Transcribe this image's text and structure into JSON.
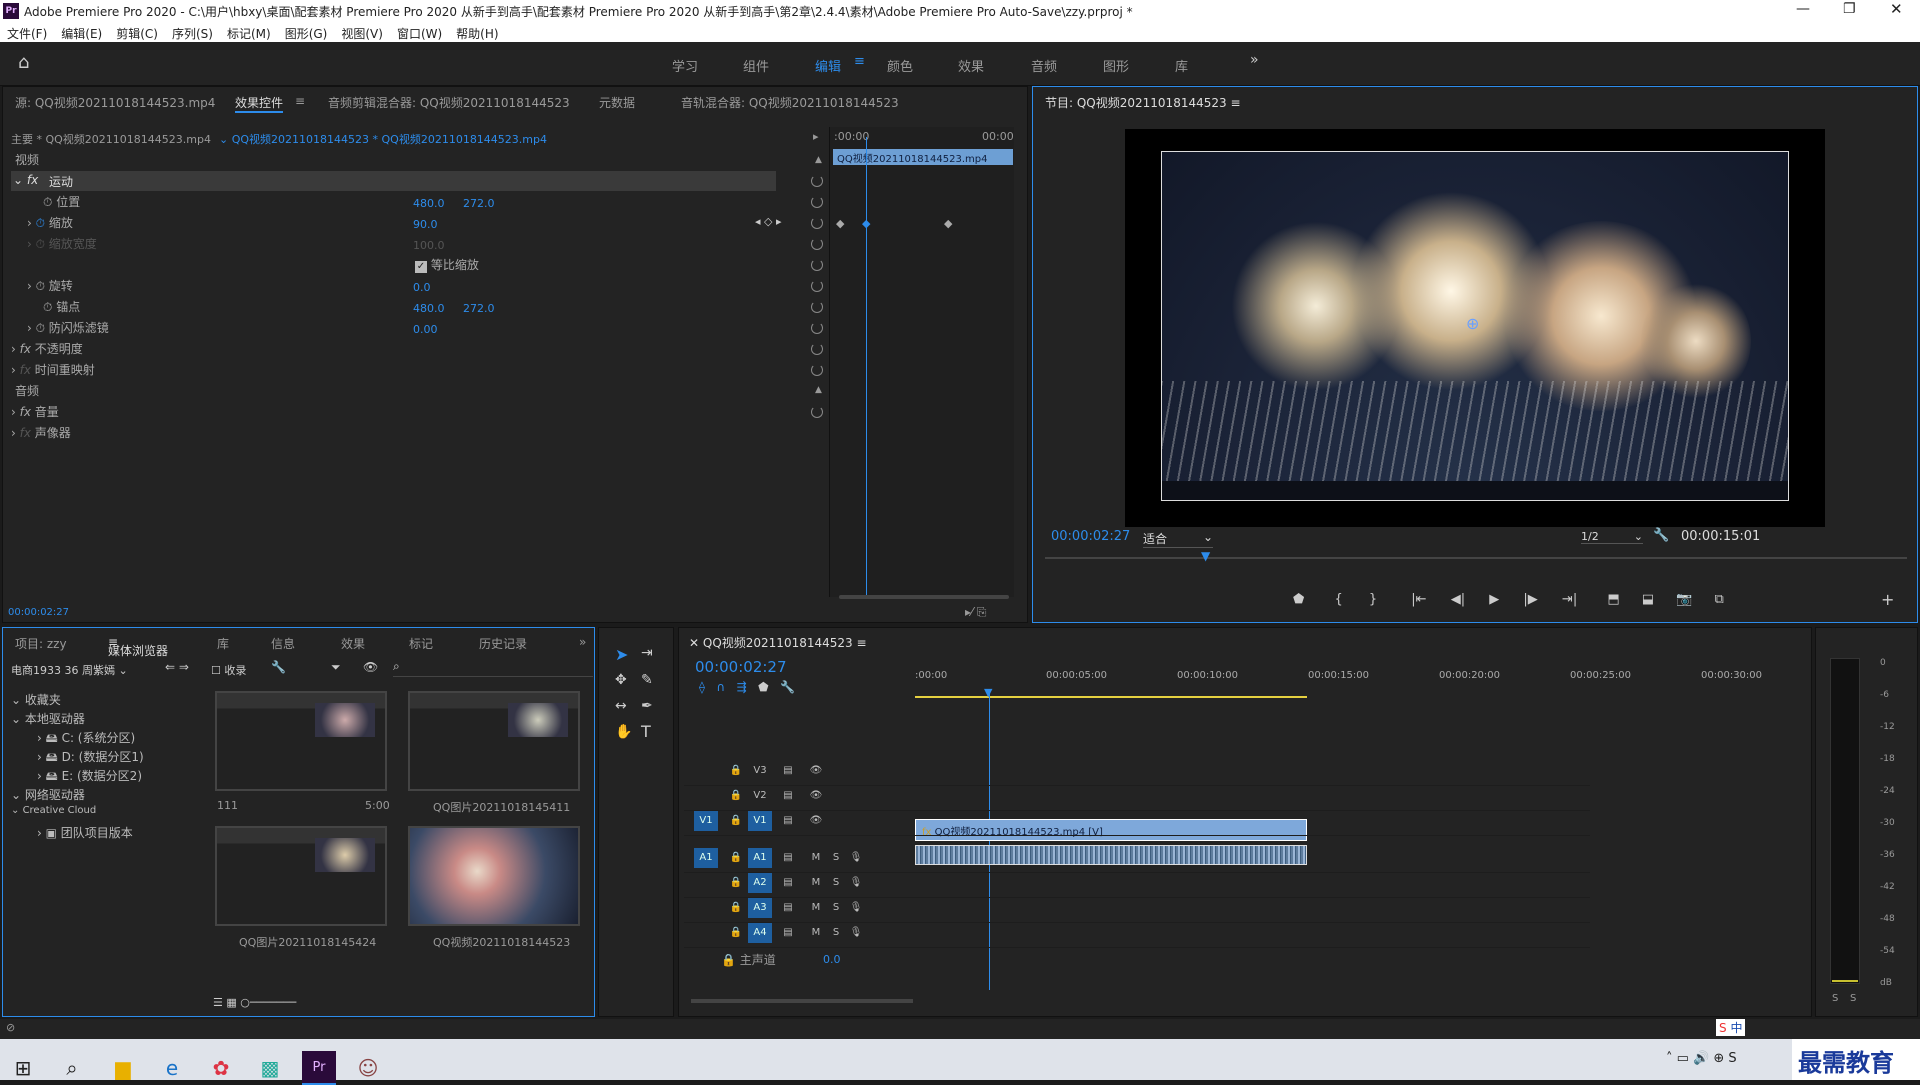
{
  "window": {
    "title": "Adobe Premiere Pro 2020 - C:\\用户\\hbxy\\桌面\\配套素材 Premiere Pro 2020 从新手到高手\\配套素材 Premiere Pro 2020 从新手到高手\\第2章\\2.4.4\\素材\\Adobe Premiere Pro Auto-Save\\zzy.prproj *",
    "app_icon": "Pr"
  },
  "menu": [
    "文件(F)",
    "编辑(E)",
    "剪辑(C)",
    "序列(S)",
    "标记(M)",
    "图形(G)",
    "视图(V)",
    "窗口(W)",
    "帮助(H)"
  ],
  "workspaces": [
    "学习",
    "组件",
    "编辑",
    "颜色",
    "效果",
    "音频",
    "图形",
    "库"
  ],
  "active_workspace": "编辑",
  "source_panel": {
    "tabs": [
      "源: QQ视频20211018144523.mp4",
      "效果控件",
      "音频剪辑混合器: QQ视频20211018144523",
      "元数据",
      "音轨混合器: QQ视频20211018144523"
    ],
    "master": "主要 * QQ视频20211018144523.mp4",
    "clip": "QQ视频20211018144523 * QQ视频20211018144523.mp4",
    "time_start": ":00:00",
    "time_end": "00:00",
    "clip_bar": "QQ视频20211018144523.mp4",
    "section_video": "视频",
    "section_audio": "音频",
    "motion": "运动",
    "position": "位置",
    "pos_x": "480.0",
    "pos_y": "272.0",
    "scale": "缩放",
    "scale_val": "90.0",
    "scale_width": "缩放宽度",
    "scale_width_val": "100.0",
    "uniform": "等比缩放",
    "rotation": "旋转",
    "rotation_val": "0.0",
    "anchor": "锚点",
    "anchor_x": "480.0",
    "anchor_y": "272.0",
    "flicker": "防闪烁滤镜",
    "flicker_val": "0.00",
    "opacity": "不透明度",
    "remap": "时间重映射",
    "volume": "音量",
    "panner": "声像器",
    "timecode": "00:00:02:27"
  },
  "program": {
    "title": "节目: QQ视频20211018144523",
    "timecode": "00:00:02:27",
    "fit": "适合",
    "res": "1/2",
    "duration": "00:00:15:01"
  },
  "project": {
    "tabs": [
      "项目: zzy",
      "媒体浏览器",
      "库",
      "信息",
      "效果",
      "标记",
      "历史记录"
    ],
    "drive": "电商1933 36 周紫嫣",
    "ingest": "收录",
    "tree": [
      "收藏夹",
      "本地驱动器",
      "C: (系统分区)",
      "D: (数据分区1)",
      "E: (数据分区2)",
      "网络驱动器",
      "Creative Cloud",
      "团队项目版本"
    ],
    "items": [
      {
        "name": "111",
        "dur": "5:00"
      },
      {
        "name": "QQ图片20211018145411",
        "dur": ""
      },
      {
        "name": "QQ图片20211018145424",
        "dur": ""
      },
      {
        "name": "QQ视频20211018144523",
        "dur": ""
      }
    ]
  },
  "timeline": {
    "title": "QQ视频20211018144523",
    "timecode": "00:00:02:27",
    "ruler": [
      ":00:00",
      "00:00:05:00",
      "00:00:10:00",
      "00:00:15:00",
      "00:00:20:00",
      "00:00:25:00",
      "00:00:30:00"
    ],
    "tracks": [
      "V3",
      "V2",
      "V1",
      "A1",
      "A2",
      "A3",
      "A4"
    ],
    "master": "主声道",
    "master_val": "0.0",
    "clip": "QQ视频20211018144523.mp4 [V]"
  },
  "meter": {
    "scale": [
      "0",
      "-6",
      "-12",
      "-18",
      "-24",
      "-30",
      "-36",
      "-42",
      "-48",
      "-54",
      "dB"
    ],
    "solo": [
      "S",
      "S"
    ]
  },
  "watermark": "最需教育",
  "ime": "中"
}
